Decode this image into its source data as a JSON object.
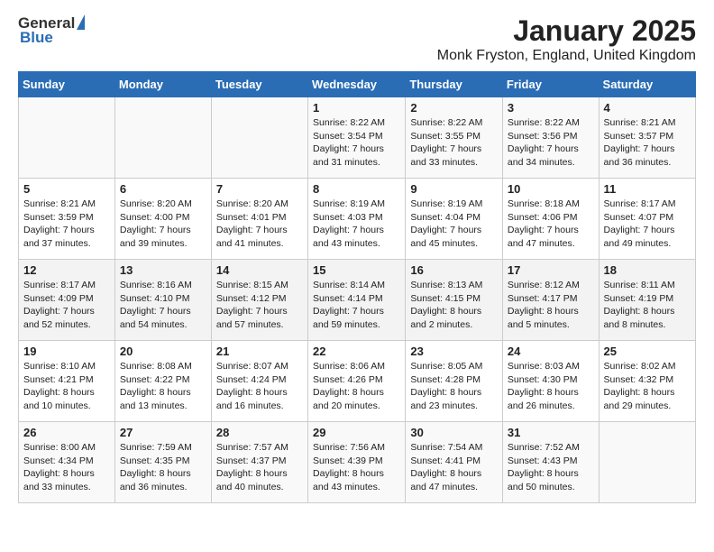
{
  "logo": {
    "general": "General",
    "blue": "Blue"
  },
  "title": "January 2025",
  "subtitle": "Monk Fryston, England, United Kingdom",
  "days_of_week": [
    "Sunday",
    "Monday",
    "Tuesday",
    "Wednesday",
    "Thursday",
    "Friday",
    "Saturday"
  ],
  "weeks": [
    [
      {
        "day": "",
        "info": ""
      },
      {
        "day": "",
        "info": ""
      },
      {
        "day": "",
        "info": ""
      },
      {
        "day": "1",
        "info": "Sunrise: 8:22 AM\nSunset: 3:54 PM\nDaylight: 7 hours and 31 minutes."
      },
      {
        "day": "2",
        "info": "Sunrise: 8:22 AM\nSunset: 3:55 PM\nDaylight: 7 hours and 33 minutes."
      },
      {
        "day": "3",
        "info": "Sunrise: 8:22 AM\nSunset: 3:56 PM\nDaylight: 7 hours and 34 minutes."
      },
      {
        "day": "4",
        "info": "Sunrise: 8:21 AM\nSunset: 3:57 PM\nDaylight: 7 hours and 36 minutes."
      }
    ],
    [
      {
        "day": "5",
        "info": "Sunrise: 8:21 AM\nSunset: 3:59 PM\nDaylight: 7 hours and 37 minutes."
      },
      {
        "day": "6",
        "info": "Sunrise: 8:20 AM\nSunset: 4:00 PM\nDaylight: 7 hours and 39 minutes."
      },
      {
        "day": "7",
        "info": "Sunrise: 8:20 AM\nSunset: 4:01 PM\nDaylight: 7 hours and 41 minutes."
      },
      {
        "day": "8",
        "info": "Sunrise: 8:19 AM\nSunset: 4:03 PM\nDaylight: 7 hours and 43 minutes."
      },
      {
        "day": "9",
        "info": "Sunrise: 8:19 AM\nSunset: 4:04 PM\nDaylight: 7 hours and 45 minutes."
      },
      {
        "day": "10",
        "info": "Sunrise: 8:18 AM\nSunset: 4:06 PM\nDaylight: 7 hours and 47 minutes."
      },
      {
        "day": "11",
        "info": "Sunrise: 8:17 AM\nSunset: 4:07 PM\nDaylight: 7 hours and 49 minutes."
      }
    ],
    [
      {
        "day": "12",
        "info": "Sunrise: 8:17 AM\nSunset: 4:09 PM\nDaylight: 7 hours and 52 minutes."
      },
      {
        "day": "13",
        "info": "Sunrise: 8:16 AM\nSunset: 4:10 PM\nDaylight: 7 hours and 54 minutes."
      },
      {
        "day": "14",
        "info": "Sunrise: 8:15 AM\nSunset: 4:12 PM\nDaylight: 7 hours and 57 minutes."
      },
      {
        "day": "15",
        "info": "Sunrise: 8:14 AM\nSunset: 4:14 PM\nDaylight: 7 hours and 59 minutes."
      },
      {
        "day": "16",
        "info": "Sunrise: 8:13 AM\nSunset: 4:15 PM\nDaylight: 8 hours and 2 minutes."
      },
      {
        "day": "17",
        "info": "Sunrise: 8:12 AM\nSunset: 4:17 PM\nDaylight: 8 hours and 5 minutes."
      },
      {
        "day": "18",
        "info": "Sunrise: 8:11 AM\nSunset: 4:19 PM\nDaylight: 8 hours and 8 minutes."
      }
    ],
    [
      {
        "day": "19",
        "info": "Sunrise: 8:10 AM\nSunset: 4:21 PM\nDaylight: 8 hours and 10 minutes."
      },
      {
        "day": "20",
        "info": "Sunrise: 8:08 AM\nSunset: 4:22 PM\nDaylight: 8 hours and 13 minutes."
      },
      {
        "day": "21",
        "info": "Sunrise: 8:07 AM\nSunset: 4:24 PM\nDaylight: 8 hours and 16 minutes."
      },
      {
        "day": "22",
        "info": "Sunrise: 8:06 AM\nSunset: 4:26 PM\nDaylight: 8 hours and 20 minutes."
      },
      {
        "day": "23",
        "info": "Sunrise: 8:05 AM\nSunset: 4:28 PM\nDaylight: 8 hours and 23 minutes."
      },
      {
        "day": "24",
        "info": "Sunrise: 8:03 AM\nSunset: 4:30 PM\nDaylight: 8 hours and 26 minutes."
      },
      {
        "day": "25",
        "info": "Sunrise: 8:02 AM\nSunset: 4:32 PM\nDaylight: 8 hours and 29 minutes."
      }
    ],
    [
      {
        "day": "26",
        "info": "Sunrise: 8:00 AM\nSunset: 4:34 PM\nDaylight: 8 hours and 33 minutes."
      },
      {
        "day": "27",
        "info": "Sunrise: 7:59 AM\nSunset: 4:35 PM\nDaylight: 8 hours and 36 minutes."
      },
      {
        "day": "28",
        "info": "Sunrise: 7:57 AM\nSunset: 4:37 PM\nDaylight: 8 hours and 40 minutes."
      },
      {
        "day": "29",
        "info": "Sunrise: 7:56 AM\nSunset: 4:39 PM\nDaylight: 8 hours and 43 minutes."
      },
      {
        "day": "30",
        "info": "Sunrise: 7:54 AM\nSunset: 4:41 PM\nDaylight: 8 hours and 47 minutes."
      },
      {
        "day": "31",
        "info": "Sunrise: 7:52 AM\nSunset: 4:43 PM\nDaylight: 8 hours and 50 minutes."
      },
      {
        "day": "",
        "info": ""
      }
    ]
  ]
}
